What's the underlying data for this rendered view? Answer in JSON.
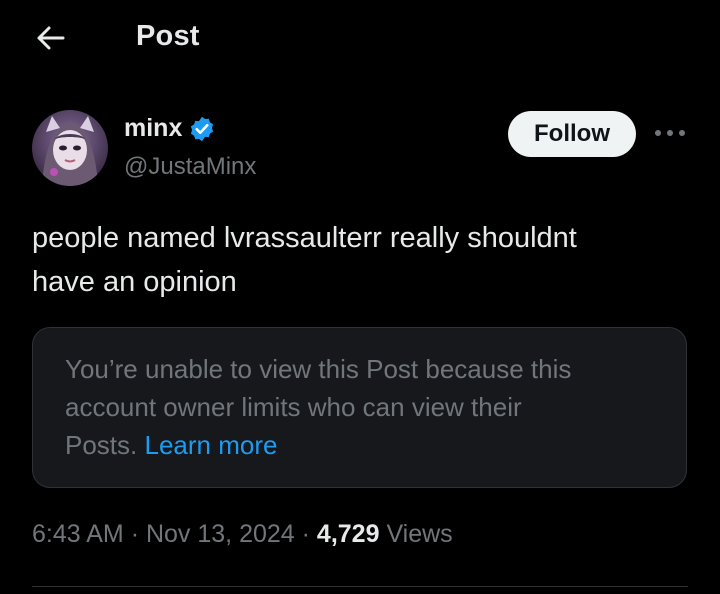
{
  "header": {
    "title": "Post",
    "back_icon": "arrow-left-icon"
  },
  "author": {
    "display_name": "minx",
    "handle": "@JustaMinx",
    "verified_icon": "verified-badge-icon",
    "verified_color": "#1d9bf0"
  },
  "actions": {
    "follow_label": "Follow",
    "more_icon": "more-horizontal-icon"
  },
  "post": {
    "text_lines": [
      "people named lvrassaulterr really shouldnt",
      "have an opinion"
    ]
  },
  "limited_notice": {
    "lines": [
      "You’re unable to view this Post because this",
      "account owner limits who can view their"
    ],
    "last_line_prefix": "Posts. ",
    "link_label": "Learn more",
    "link_color": "#1d9bf0"
  },
  "meta": {
    "time": "6:43 AM",
    "separator": "·",
    "date": "Nov 13, 2024",
    "views_count": "4,729",
    "views_label": "Views"
  }
}
